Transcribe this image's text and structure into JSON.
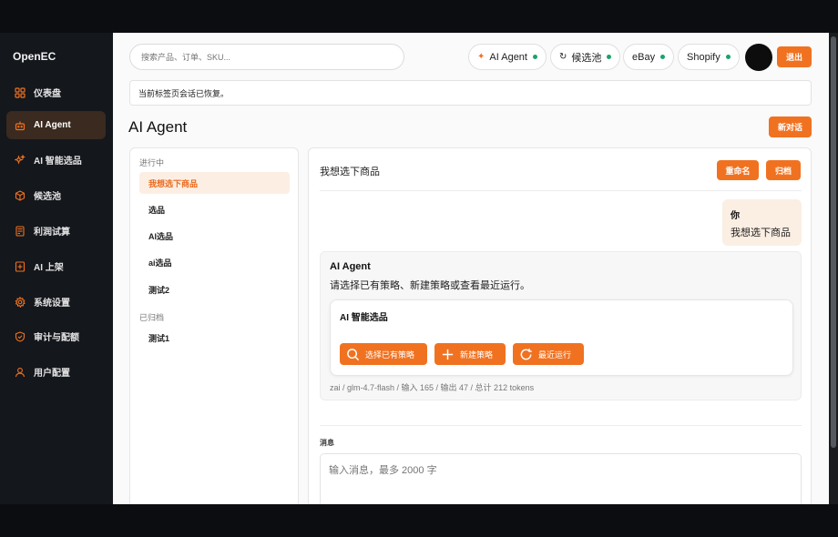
{
  "app": {
    "brand": "OpenEC"
  },
  "sidebar": {
    "items": [
      {
        "label": "仪表盘",
        "icon": "dashboard-icon"
      },
      {
        "label": "AI Agent",
        "icon": "bot-icon",
        "active": true
      },
      {
        "label": "AI 智能选品",
        "icon": "sparkle-icon"
      },
      {
        "label": "候选池",
        "icon": "box-icon"
      },
      {
        "label": "利润试算",
        "icon": "calculator-icon"
      },
      {
        "label": "AI 上架",
        "icon": "upload-icon"
      },
      {
        "label": "系统设置",
        "icon": "gear-icon"
      },
      {
        "label": "审计与配额",
        "icon": "shield-icon"
      },
      {
        "label": "用户配置",
        "icon": "user-icon"
      }
    ]
  },
  "header": {
    "search_placeholder": "搜索产品、订单、SKU...",
    "pills": [
      {
        "label": "AI Agent",
        "lead": "✦"
      },
      {
        "label": "候选池",
        "lead": "↻"
      },
      {
        "label": "eBay",
        "lead": ""
      },
      {
        "label": "Shopify",
        "lead": ""
      }
    ],
    "logout_label": "退出",
    "status_color": "#1aa36b",
    "accent_color": "#f07221"
  },
  "notice": {
    "text": "当前标签页会话已恢复。"
  },
  "page": {
    "title": "AI Agent",
    "new_chat_label": "新对话"
  },
  "conversations": {
    "active_group": "进行中",
    "active_items": [
      "我想选下商品",
      "选品",
      "AI选品",
      "ai选品",
      "测试2"
    ],
    "archived_group": "已归档",
    "archived_items": [
      "测试1"
    ]
  },
  "chat": {
    "title": "我想选下商品",
    "rename_label": "重命名",
    "archive_label": "归档",
    "user": {
      "who": "你",
      "message": "我想选下商品"
    },
    "agent": {
      "name": "AI Agent",
      "message": "请选择已有策略、新建策略或查看最近运行。",
      "card_title": "AI 智能选品",
      "actions": [
        {
          "label": "选择已有策略",
          "icon": "search-icon"
        },
        {
          "label": "新建策略",
          "icon": "plus-icon"
        },
        {
          "label": "最近运行",
          "icon": "refresh-icon"
        }
      ],
      "tokens": "zai / glm-4.7-flash / 输入 165 / 输出 47 / 总计 212 tokens"
    },
    "message_label": "消息",
    "message_placeholder": "输入消息，最多 2000 字"
  }
}
